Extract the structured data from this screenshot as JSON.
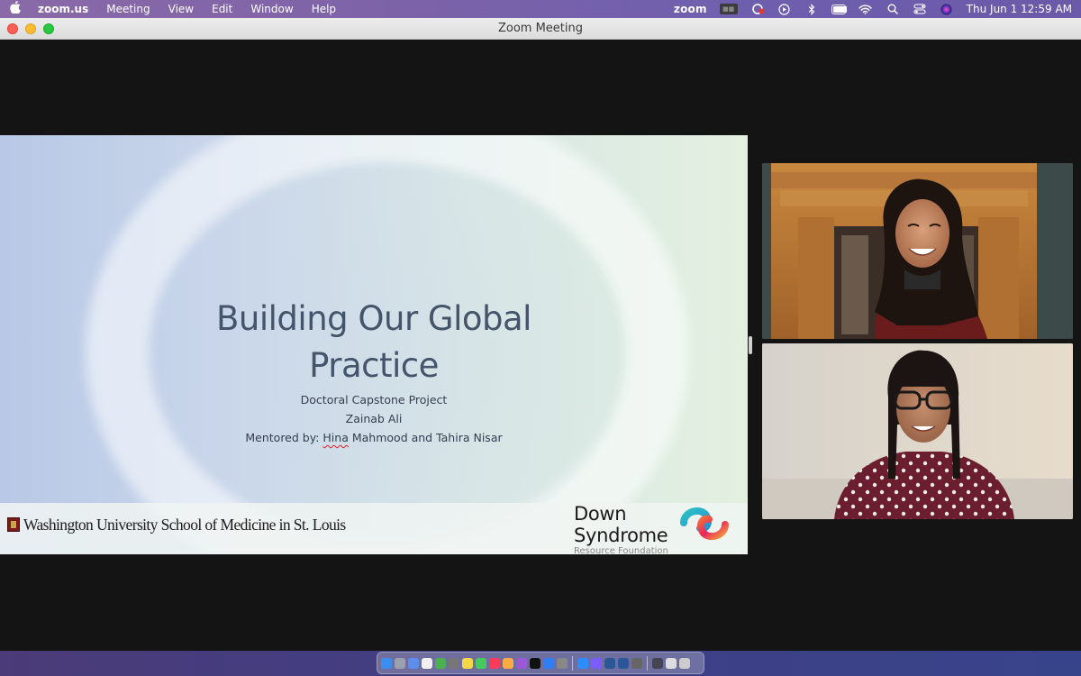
{
  "menubar": {
    "app_name": "zoom.us",
    "menus": [
      "Meeting",
      "View",
      "Edit",
      "Window",
      "Help"
    ],
    "tray_zoom_label": "zoom",
    "clock": "Thu Jun 1  12:59 AM"
  },
  "window": {
    "title": "Zoom Meeting"
  },
  "slide": {
    "title_line1": "Building Our Global",
    "title_line2": "Practice",
    "subtitle1": "Doctoral Capstone Project",
    "subtitle2": "Zainab Ali",
    "mentored_prefix": "Mentored by: ",
    "mentor1": "Hina",
    "mentored_rest": " Mahmood and Tahira Nisar",
    "footer_left": "Washington University School of Medicine in St. Louis",
    "footer_right_line1": "Down",
    "footer_right_line2": "Syndrome",
    "footer_right_small": "Resource Foundation"
  },
  "participants": [
    {
      "icon": "participant-video"
    },
    {
      "icon": "participant-video"
    }
  ],
  "colors": {
    "menubar": "#7d63a8",
    "meeting_bg": "#141414",
    "slide_title": "#44546a"
  }
}
